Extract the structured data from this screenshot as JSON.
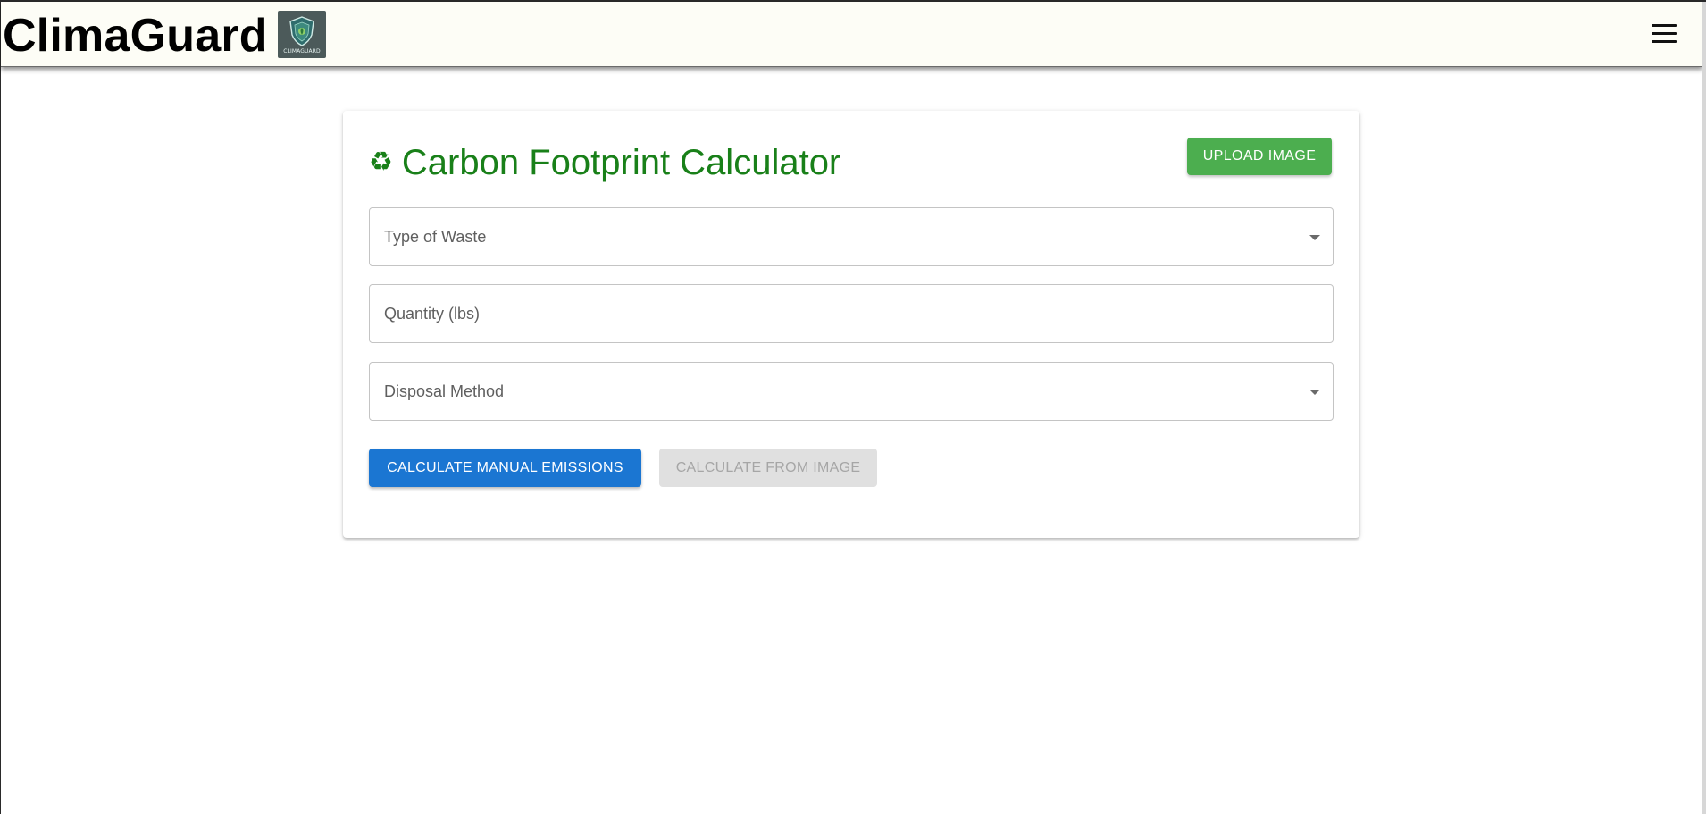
{
  "header": {
    "brand": "ClimaGuard",
    "logo_text": "CLIMAGUARD",
    "menu_icon": "hamburger-menu-icon"
  },
  "calculator": {
    "title": "Carbon Footprint Calculator",
    "title_icon": "recycle-icon",
    "upload_label": "UPLOAD IMAGE",
    "fields": {
      "waste_type": {
        "label": "Type of Waste",
        "value": ""
      },
      "quantity": {
        "label": "Quantity (lbs)",
        "value": ""
      },
      "disposal_method": {
        "label": "Disposal Method",
        "value": ""
      }
    },
    "calculate_manual_label": "CALCULATE MANUAL EMISSIONS",
    "calculate_image_label": "CALCULATE FROM IMAGE"
  },
  "colors": {
    "header_bg": "#fdfdf6",
    "title_green": "#198019",
    "upload_green": "#4cae4f",
    "primary_blue": "#1b76d2",
    "disabled_bg": "#e0e0e0",
    "disabled_text": "#a6a6a6",
    "field_border": "#c4c4c4"
  }
}
